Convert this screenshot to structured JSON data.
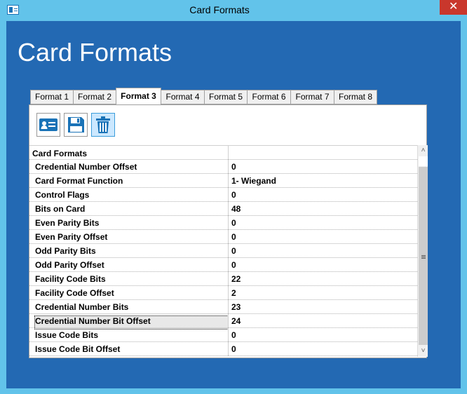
{
  "window": {
    "title": "Card Formats",
    "close_glyph": "✕"
  },
  "page": {
    "heading": "Card Formats"
  },
  "tabs": [
    {
      "label": "Format 1"
    },
    {
      "label": "Format 2"
    },
    {
      "label": "Format 3"
    },
    {
      "label": "Format 4"
    },
    {
      "label": "Format 5"
    },
    {
      "label": "Format 6"
    },
    {
      "label": "Format 7"
    },
    {
      "label": "Format 8"
    }
  ],
  "active_tab": "Format 3",
  "toolbar": {
    "icons": [
      "id-card-icon",
      "save-icon",
      "trash-icon"
    ]
  },
  "grid": {
    "category": "Card Formats",
    "rows": [
      {
        "name": "Credential Number Offset",
        "value": "0"
      },
      {
        "name": "Card Format Function",
        "value": "1- Wiegand"
      },
      {
        "name": "Control Flags",
        "value": "0"
      },
      {
        "name": "Bits on Card",
        "value": "48"
      },
      {
        "name": "Even Parity Bits",
        "value": "0"
      },
      {
        "name": "Even Parity Offset",
        "value": "0"
      },
      {
        "name": "Odd Parity Bits",
        "value": "0"
      },
      {
        "name": "Odd Parity Offset",
        "value": "0"
      },
      {
        "name": "Facility Code Bits",
        "value": "22"
      },
      {
        "name": "Facility Code Offset",
        "value": "2"
      },
      {
        "name": "Credential Number Bits",
        "value": "23"
      },
      {
        "name": "Credential Number Bit Offset",
        "value": "24"
      },
      {
        "name": "Issue Code Bits",
        "value": "0"
      },
      {
        "name": "Issue Code Bit Offset",
        "value": "0"
      }
    ],
    "selected_row": "Credential Number Bit Offset"
  },
  "scrollbar": {
    "up_glyph": "˄",
    "down_glyph": "˅"
  },
  "colors": {
    "client_bg": "#2369b3",
    "titlebar_bg": "#62c3ea",
    "close_bg": "#c9372c"
  }
}
